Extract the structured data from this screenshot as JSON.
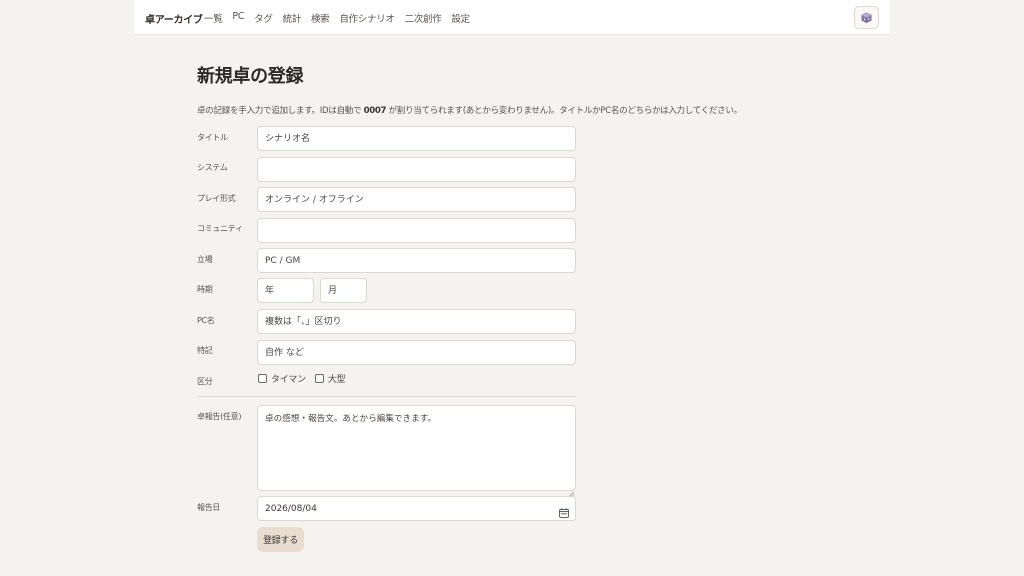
{
  "app": {
    "brand": "卓アーカイブ",
    "nav": [
      "一覧",
      "PC",
      "タグ",
      "統計",
      "検索",
      "自作シナリオ",
      "二次創作",
      "設定"
    ],
    "theme_icon": "dice-icon"
  },
  "page": {
    "title": "新規卓の登録",
    "description_pre": "卓の記録を手入力で追加します。IDは自動で",
    "description_id": "0007",
    "description_post": "が割り当てられます(あとから変わりません)。タイトルかPC名のどちらかは入力してください。"
  },
  "form": {
    "title": {
      "label": "タイトル",
      "placeholder": "シナリオ名",
      "value": ""
    },
    "system": {
      "label": "システム",
      "placeholder": "",
      "value": ""
    },
    "play_style": {
      "label": "プレイ形式",
      "placeholder": "オンライン / オフライン",
      "value": ""
    },
    "community": {
      "label": "コミュニティ",
      "placeholder": "",
      "value": ""
    },
    "role": {
      "label": "立場",
      "placeholder": "PC / GM",
      "value": ""
    },
    "period": {
      "label": "時期",
      "year_placeholder": "年",
      "month_placeholder": "月"
    },
    "pc_name": {
      "label": "PC名",
      "placeholder": "複数は「、」区切り",
      "value": ""
    },
    "note": {
      "label": "特記",
      "placeholder": "自作 など",
      "value": ""
    },
    "category": {
      "label": "区分",
      "options": [
        "タイマン",
        "大型"
      ]
    },
    "report": {
      "label": "卓報告(任意)",
      "placeholder": "卓の感想・報告文。あとから編集できます。"
    },
    "report_date": {
      "label": "報告日",
      "value": "2026/08/04"
    },
    "submit_label": "登録する"
  },
  "colors": {
    "background": "#f5f3ef",
    "submit_bg": "#e9ddd0",
    "border": "#dcd7d1"
  }
}
